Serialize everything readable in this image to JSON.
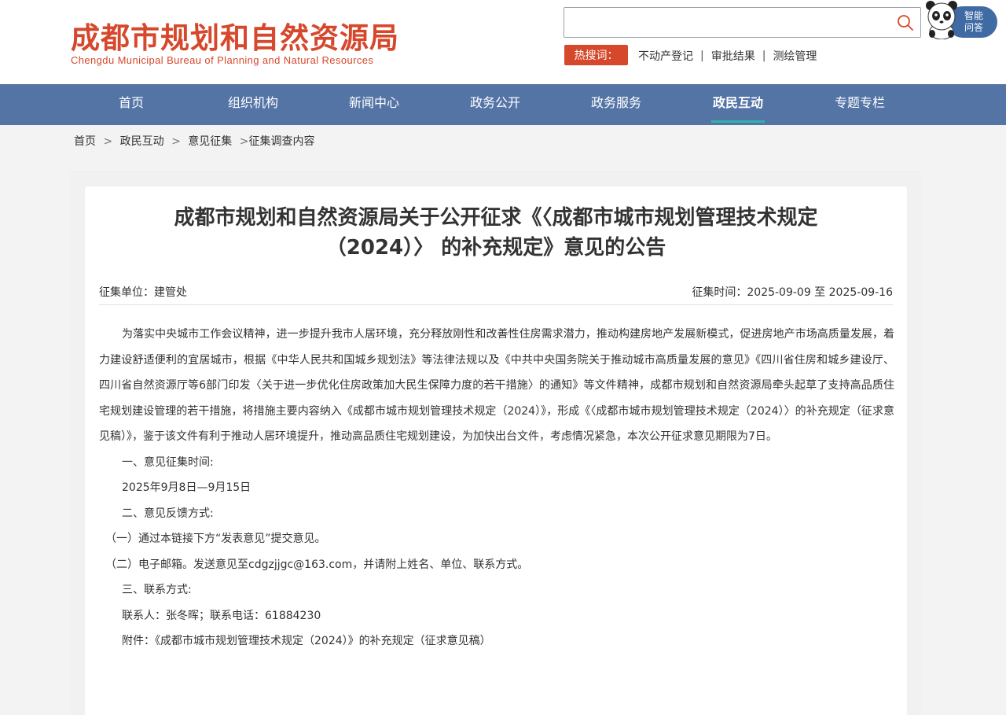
{
  "header": {
    "logo_cn": "成都市规划和自然资源局",
    "logo_en": "Chengdu Municipal Bureau of Planning and Natural Resources",
    "search_placeholder": "",
    "hot_label": "热搜词：",
    "hot_links": [
      "不动产登记",
      "审批结果",
      "测绘管理"
    ],
    "separator": "|",
    "ai_label_line1": "智能",
    "ai_label_line2": "问答"
  },
  "nav": {
    "items": [
      "首页",
      "组织机构",
      "新闻中心",
      "政务公开",
      "政务服务",
      "政民互动",
      "专题专栏"
    ],
    "active_index": 5
  },
  "breadcrumb": {
    "items": [
      "首页",
      "政民互动",
      "意见征集",
      "征集调查内容"
    ],
    "separator": ">"
  },
  "article": {
    "title_line1": "成都市规划和自然资源局关于公开征求《〈成都市城市规划管理技术规定",
    "title_line2": "（2024）〉 的补充规定》意见的公告",
    "unit": "征集单位：建管处",
    "time": "征集时间：2025-09-09 至 2025-09-16",
    "intro": "为落实中央城市工作会议精神，进一步提升我市人居环境，充分释放刚性和改善性住房需求潜力，推动构建房地产发展新模式，促进房地产市场高质量发展，着力建设舒适便利的宜居城市，根据《中华人民共和国城乡规划法》等法律法规以及《中共中央国务院关于推动城市高质量发展的意见》《四川省住房和城乡建设厅、四川省自然资源厅等6部门印发〈关于进一步优化住房政策加大民生保障力度的若干措施〉的通知》等文件精神，成都市规划和自然资源局牵头起草了支持高品质住宅规划建设管理的若干措施，将措施主要内容纳入《成都市城市规划管理技术规定（2024）》，形成《〈成都市城市规划管理技术规定（2024）〉的补充规定（征求意见稿）》，鉴于该文件有利于推动人居环境提升，推动高品质住宅规划建设，为加快出台文件，考虑情况紧急，本次公开征求意见期限为7日。",
    "lines": [
      "一、意见征集时间:",
      "2025年9月8日—9月15日",
      "二、意见反馈方式:",
      "（一）通过本链接下方“发表意见”提交意见。",
      "（二）电子邮箱。发送意见至cdgzjjgc@163.com，并请附上姓名、单位、联系方式。",
      "三、联系方式:",
      "联系人：张冬晖；联系电话：61884230",
      "附件：《成都市城市规划管理技术规定（2024）》的补充规定（征求意见稿）"
    ]
  },
  "colors": {
    "brand_red": "#d6482c",
    "nav_blue": "#5574a6",
    "active_underline": "#2fb3a6",
    "ai_blue": "#3f6aa4"
  }
}
